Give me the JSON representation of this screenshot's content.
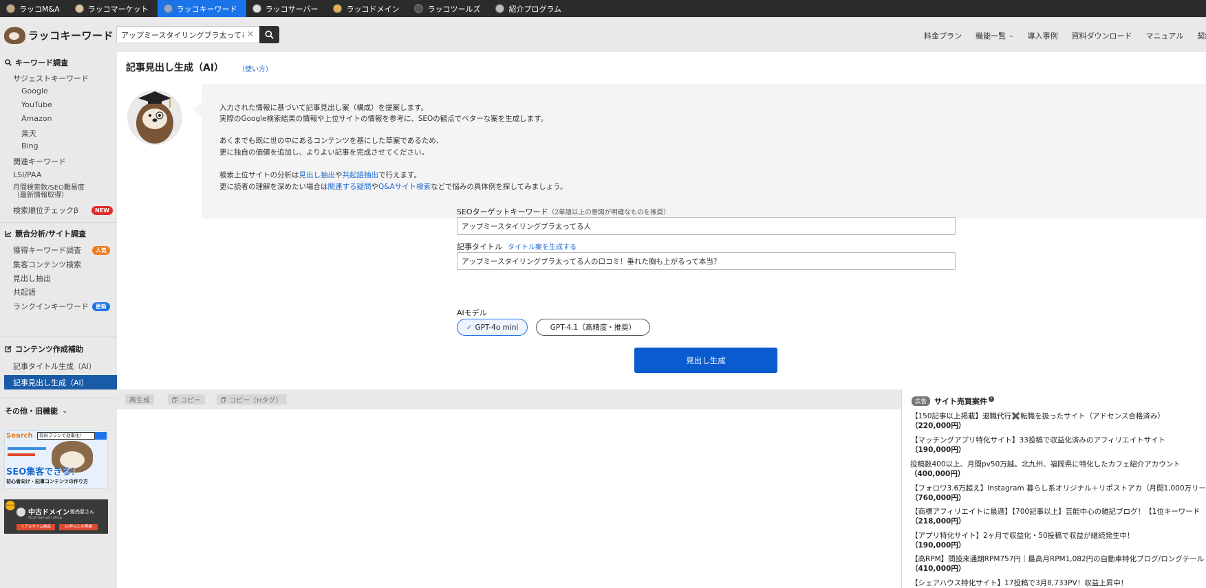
{
  "topbar": {
    "tabs": [
      {
        "label": "ラッコM&A",
        "icon": "otter-icon"
      },
      {
        "label": "ラッコマーケット",
        "icon": "market-icon"
      },
      {
        "label": "ラッコキーワード",
        "icon": "keyword-icon"
      },
      {
        "label": "ラッコサーバー",
        "icon": "server-icon"
      },
      {
        "label": "ラッコドメイン",
        "icon": "domain-icon"
      },
      {
        "label": "ラッコツールズ",
        "icon": "tools-icon"
      },
      {
        "label": "紹介プログラム",
        "icon": "referral-icon"
      }
    ]
  },
  "header": {
    "logo_text": "ラッコキーワード",
    "search_value": "アップミースタイリングブラ太ってる人",
    "nav": [
      "料金プラン",
      "機能一覧",
      "導入事例",
      "資料ダウンロード",
      "マニュアル",
      "契約管"
    ]
  },
  "sidebar": {
    "section_keyword": "キーワード調査",
    "suggest": "サジェストキーワード",
    "suggest_sources": [
      "Google",
      "YouTube",
      "Amazon",
      "楽天",
      "Bing"
    ],
    "related": "関連キーワード",
    "lsi": "LSI/PAA",
    "monthly_line1": "月間検索数/SEO難易度",
    "monthly_line2": "（最新情報取得）",
    "rank_check": "検索順位チェックβ",
    "badge_new": "NEW",
    "section_competitor": "競合分析/サイト調査",
    "acquired": "獲得キーワード調査",
    "badge_popular": "人気",
    "attract": "集客コンテンツ検索",
    "heading_extract": "見出し抽出",
    "cooccur": "共起語",
    "rankin": "ランクインキーワード",
    "badge_updated": "更新",
    "section_content": "コンテンツ作成補助",
    "title_gen": "記事タイトル生成（AI）",
    "heading_gen": "記事見出し生成（AI）",
    "others": "その他・旧機能",
    "banner1": {
      "search": "Search",
      "box": "有料プランで効率化！",
      "main": "SEO集客できる！",
      "sub": "初心者向け・記事コンテンツの作り方"
    },
    "banner2": {
      "badge": "SEOに強い",
      "title": "中古ドメイン",
      "title_suffix": "販売屋さん",
      "subtitle": "OLD domain shop",
      "tag1": "リアルタイム納品",
      "tag2": "10年以上の実績"
    }
  },
  "main": {
    "title": "記事見出し生成（AI）",
    "usage_link": "（使い方）",
    "info": {
      "line1": "入力された情報に基づいて記事見出し案（構成）を提案します。",
      "line2": "実際のGoogle検索結果の情報や上位サイトの情報を参考に、SEOの観点でベターな案を生成します。",
      "line3": "あくまでも既に世の中にあるコンテンツを基にした草案であるため、",
      "line4": "更に独自の価値を追加し、よりよい記事を完成させてください。",
      "line5_a": "検索上位サイトの分析は",
      "line5_link1": "見出し抽出",
      "line5_b": "や",
      "line5_link2": "共起語抽出",
      "line5_c": "で行えます。",
      "line6_a": "更に読者の理解を深めたい場合は",
      "line6_link1": "関連する疑問",
      "line6_b": "や",
      "line6_link2": "Q&Aサイト検索",
      "line6_c": "などで悩みの具体例を探してみましょう。"
    },
    "form": {
      "keyword_label": "SEOターゲットキーワード",
      "keyword_note": "（2単語以上の意図が明確なものを推奨）",
      "keyword_value": "アップミースタイリングブラ太ってる人",
      "title_label": "記事タイトル",
      "title_gen_link": "タイトル案を生成する",
      "title_value": "アップミースタイリングブラ太ってる人の口コミ！垂れた胸も上がるって本当？",
      "model_label": "AIモデル",
      "model_options": [
        "GPT-4o mini",
        "GPT-4.1（高精度・推奨）"
      ],
      "selected_model": "GPT-4o mini",
      "generate_button": "見出し生成"
    }
  },
  "output": {
    "regen": "再生成",
    "copy": "コピー",
    "copy_h": "コピー（Hタグ）"
  },
  "ads": {
    "badge": "広告",
    "title": "サイト売買案件",
    "items": [
      {
        "text": "【150記事以上掲載】退職代行✖️転職を扱ったサイト（アドセンス合格済み）",
        "price": "（220,000円）"
      },
      {
        "text": "【マッチングアプリ特化サイト】33投稿で収益化済みのアフィリエイトサイト",
        "price": "（190,000円）"
      },
      {
        "text": "投稿数400以上、月間pv50万越。北九州、福岡県に特化したカフェ紹介アカウント",
        "price": "（400,000円）"
      },
      {
        "text": "【フォロワ3.6万超え】Instagram 暮らし系オリジナル＋リポストアカ（月間1,000万リー",
        "price": "（760,000円）"
      },
      {
        "text": "【商標アフィリエイトに最適】【700記事以上】芸能中心の雑記ブログ！【1位キーワード",
        "price": "（218,000円）"
      },
      {
        "text": "【アプリ特化サイト】2ヶ月で収益化・50投稿で収益が継続発生中！",
        "price": "（190,000円）"
      },
      {
        "text": "【高RPM】間設来通期RPM757円｜最高月RPM1,082円の自動車特化ブログ/ロングテール",
        "price": "（410,000円）"
      },
      {
        "text": "【シェアハウス特化サイト】17投稿で3月8,733PV！収益上昇中！",
        "price": ""
      }
    ]
  },
  "colors": {
    "accent": "#1a73e8",
    "sidebar_active": "#1a5ba8",
    "primary_button": "#0a5bd0",
    "topbar": "#2b2b2b"
  }
}
